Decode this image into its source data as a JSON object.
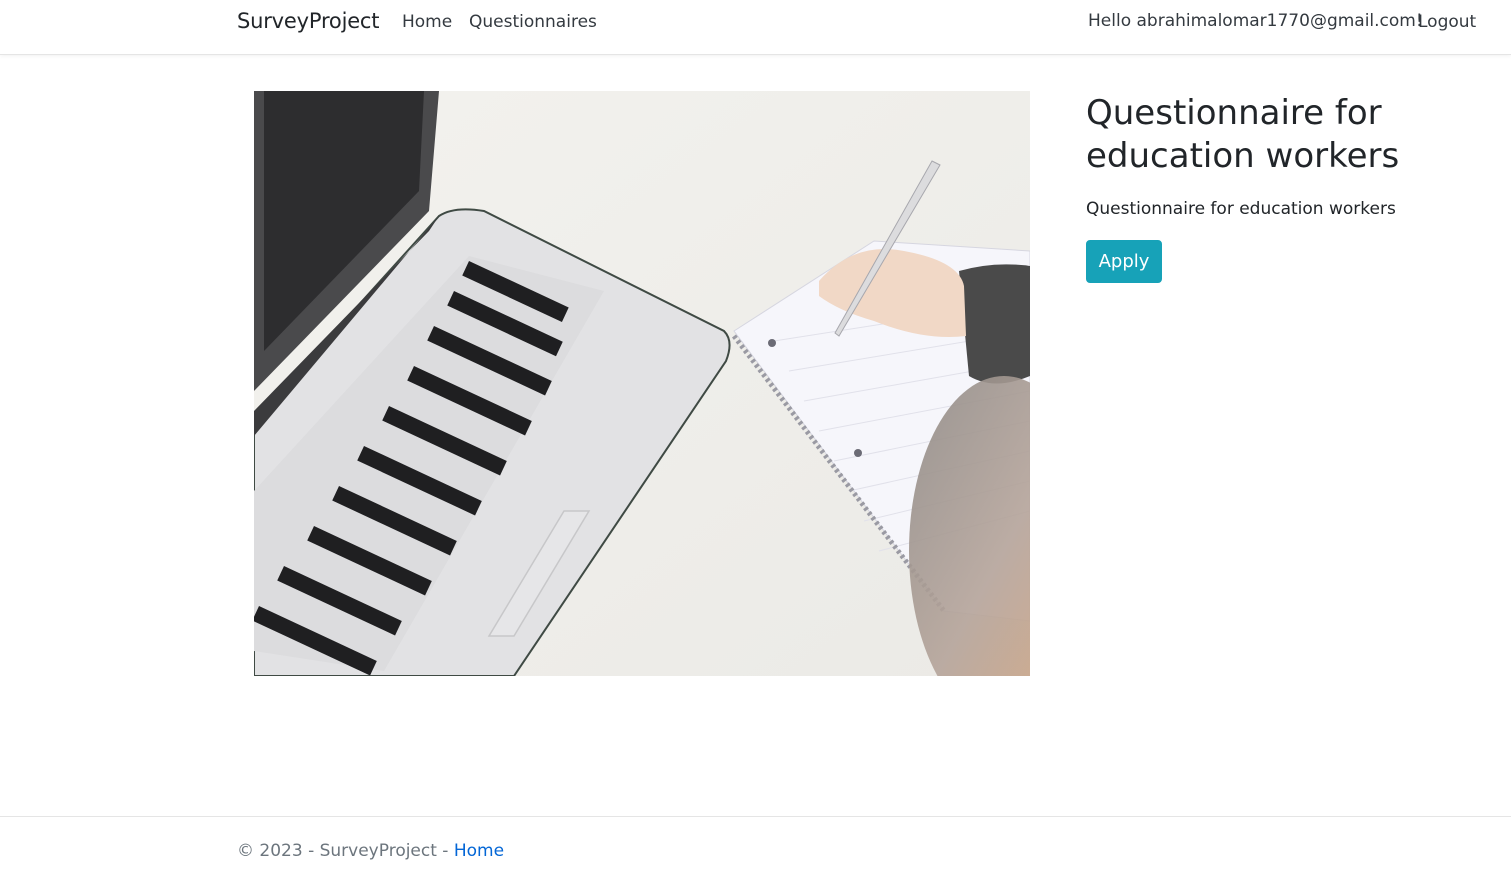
{
  "navbar": {
    "brand": "SurveyProject",
    "links": [
      {
        "label": "Home"
      },
      {
        "label": "Questionnaires"
      }
    ],
    "greeting": "Hello abrahimalomar1770@gmail.com!",
    "logout_label": "Logout"
  },
  "main": {
    "image_alt": "laptop-and-notebook-photo",
    "title": "Questionnaire for education workers",
    "description": "Questionnaire for education workers",
    "apply_label": "Apply"
  },
  "footer": {
    "copyright": "© 2023 - SurveyProject - ",
    "home_link": "Home"
  },
  "colors": {
    "accent": "#17a2b8",
    "link": "#0366d6",
    "text": "#212529",
    "muted": "#6c757d"
  }
}
